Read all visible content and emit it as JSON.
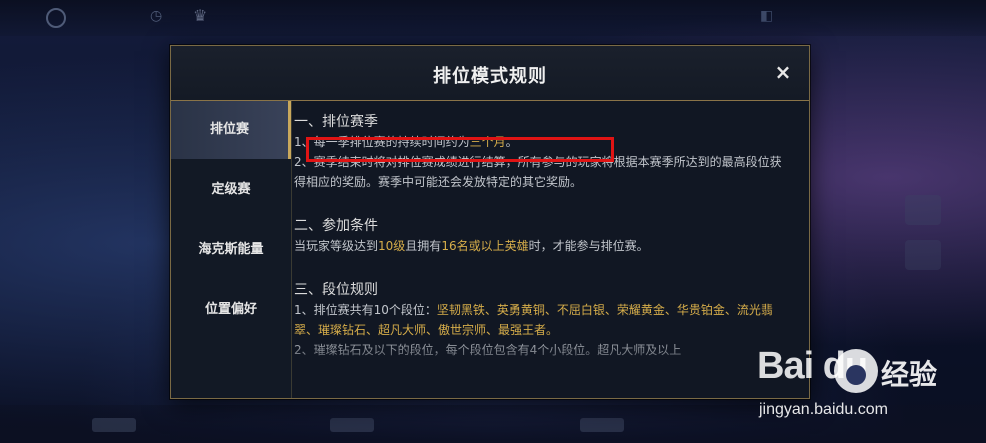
{
  "dialog": {
    "title": "排位模式规则",
    "close_label": "×"
  },
  "tabs": [
    {
      "label": "排位赛",
      "active": true
    },
    {
      "label": "定级赛",
      "active": false
    },
    {
      "label": "海克斯能量",
      "active": false
    },
    {
      "label": "位置偏好",
      "active": false
    }
  ],
  "content": {
    "s1_title": "一、排位赛季",
    "s1_p1_a": "1、每一季排位赛的持续时间约为",
    "s1_p1_b": "三个月",
    "s1_p1_c": "。",
    "s1_p2": "2、赛季结束时将对排位赛成绩进行结算，所有参与的玩家将根据本赛季所达到的最高段位获得相应的奖励。赛季中可能还会发放特定的其它奖励。",
    "s2_title": "二、参加条件",
    "s2_p1_a": "当玩家等级达到",
    "s2_p1_b": "10级",
    "s2_p1_c": "且拥有",
    "s2_p1_d": "16名或以上英雄",
    "s2_p1_e": "时，才能参与排位赛。",
    "s3_title": "三、段位规则",
    "s3_p1_a": "1、排位赛共有10个段位：",
    "s3_p1_b": "坚韧黑铁、英勇黄铜、不屈白银、荣耀黄金、华贵铂金、流光翡翠、璀璨钻石、超凡大师、傲世宗师、最强王者。",
    "s3_p2": "2、璀璨钻石及以下的段位，每个段位包含有4个小段位。超凡大师及以上"
  },
  "watermark": {
    "logo_text": "Bai du",
    "brand_text": "经验",
    "url": "jingyan.baidu.com"
  },
  "colors": {
    "accent_gold": "#d6ad4a",
    "highlight_red": "#e01414",
    "dialog_bg": "#111723"
  }
}
